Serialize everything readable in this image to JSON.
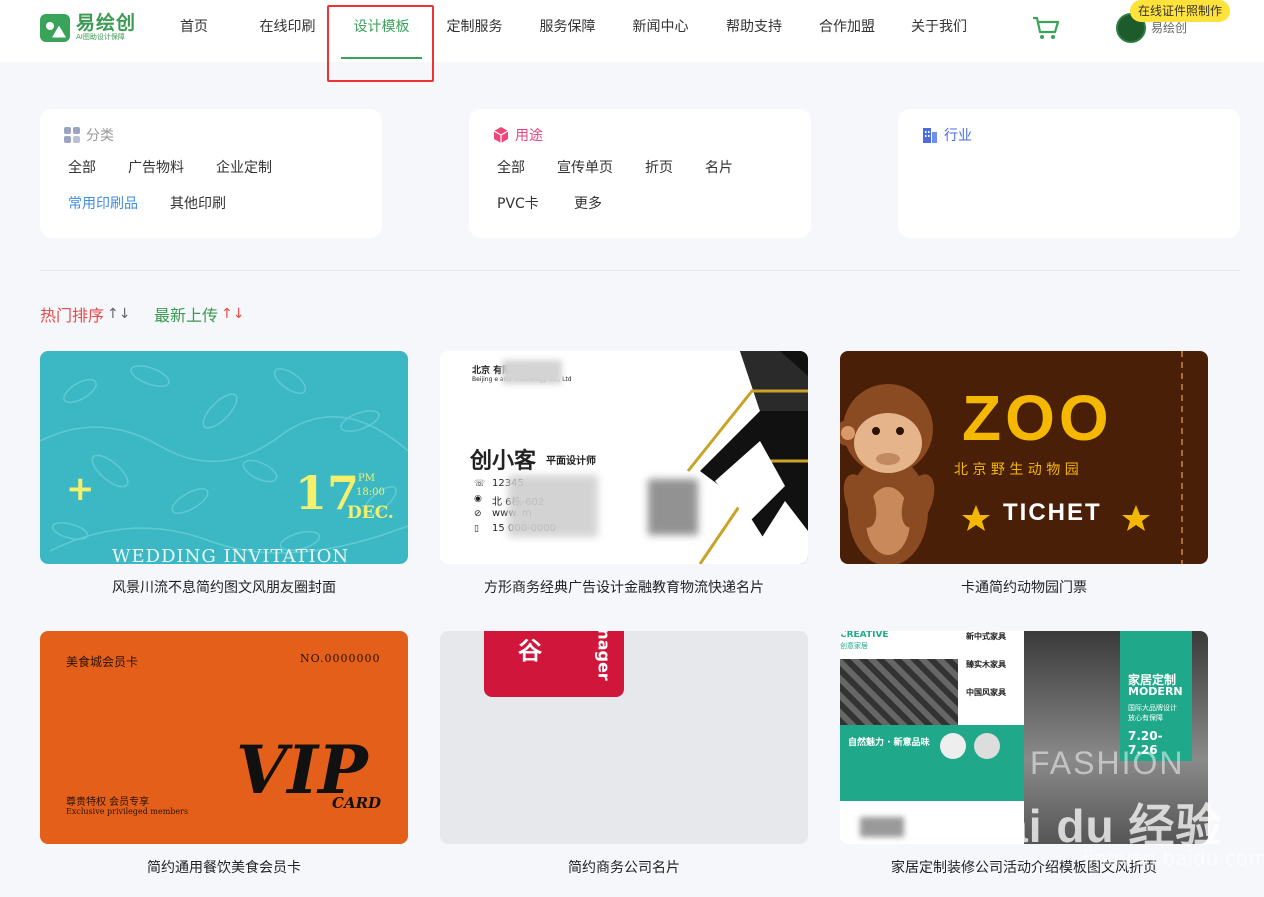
{
  "header": {
    "logo_name": "易绘创",
    "logo_sub": "AI图助设计保障",
    "nav": [
      "首页",
      "在线印刷",
      "设计模板",
      "定制服务",
      "服务保障",
      "新闻中心",
      "帮助支持",
      "合作加盟",
      "关于我们"
    ],
    "active_index": 2,
    "username": "易绘创",
    "badge": "在线证件照制作"
  },
  "filters": {
    "category": {
      "title": "分类",
      "tags": [
        "全部",
        "广告物料",
        "企业定制",
        "常用印刷品",
        "其他印刷"
      ],
      "active": "常用印刷品"
    },
    "usage": {
      "title": "用途",
      "tags": [
        "全部",
        "宣传单页",
        "折页",
        "名片",
        "PVC卡",
        "更多"
      ]
    },
    "industry": {
      "title": "行业"
    }
  },
  "sort": {
    "hot": "热门排序",
    "newest": "最新上传",
    "arrows": "↑↓"
  },
  "templates": [
    {
      "title": "风景川流不息简约图文风朋友圈封面",
      "day": "17",
      "pm": "PM",
      "time": "18:00",
      "month": "DEC.",
      "caption": "WEDDING INVITATION"
    },
    {
      "title": "方形商务经典广告设计金融教育物流快递名片",
      "company": "北京          有限公司",
      "company_en": "Beijing               e and Technology Co., Ltd",
      "name": "创小客",
      "role": "平面设计师",
      "phone": "12345",
      "addr": "北         6栋-602",
      "web": "www.        m",
      "mobile": "15    000-0000"
    },
    {
      "title": "卡通简约动物园门票",
      "zoo": "ZOO",
      "zoo_cn": "北 京 野 生 动 物 园",
      "ticket": "TICHET"
    },
    {
      "title": "简约通用餐饮美食会员卡",
      "club": "美食城会员卡",
      "number": "NO.0000000",
      "vip": "VIP",
      "card": "CARD",
      "perk": "尊贵特权  会员专享",
      "perk_en": "Exclusive privileged members"
    },
    {
      "title": "简约商务公司名片",
      "word1": "谷",
      "word2": "nager"
    },
    {
      "title": "家居定制装修公司活动介绍模板图文风折页",
      "creative": "CREATIVE",
      "creative_cn": "创意家居",
      "heading": "家居定制",
      "modern": "MODERN",
      "desc": "国际大品牌设计\n放心有保障",
      "date": "7.20-7.26",
      "fashion": "FASHION",
      "items": [
        "新中式家具",
        "臻实木家具",
        "中国风家具"
      ],
      "band": "自然魅力 · 新意品味"
    }
  ],
  "watermark": {
    "text": "Bai du 经验",
    "sub": "jingyan.baidu.com"
  },
  "colors": {
    "green": "#3aa35a",
    "active_blue": "#3e8de0",
    "hot_red": "#e84a4a",
    "teal": "#3cb8c4",
    "zoo_bg": "#4a1f08",
    "zoo_yellow": "#f5b800",
    "vip_orange": "#e4601a",
    "home_teal": "#1fa98a"
  }
}
